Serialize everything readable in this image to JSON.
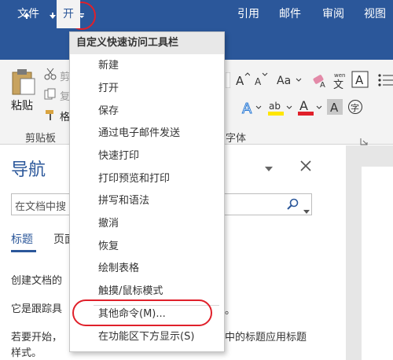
{
  "quick_access": {
    "undo_icon": "undo-up-arrow-icon",
    "redo_icon": "redo-down-arrow-icon",
    "customize_icon": "customize-dropdown-icon"
  },
  "tabs": [
    "文件",
    "开",
    "引用",
    "邮件",
    "审阅",
    "视图"
  ],
  "ribbon": {
    "paste_label": "粘贴",
    "cut_label": "剪",
    "copy_label": "复",
    "format_painter_label": "格",
    "clipboard_group": "剪贴板",
    "font_group": "字体"
  },
  "menu": {
    "header": "自定义快速访问工具栏",
    "items": [
      "新建",
      "打开",
      "保存",
      "通过电子邮件发送",
      "快速打印",
      "打印预览和打印",
      "拼写和语法",
      "撤消",
      "恢复",
      "绘制表格",
      "触摸/鼠标模式"
    ],
    "more_commands": "其他命令(M)...",
    "show_below": "在功能区下方显示(S)"
  },
  "nav": {
    "title": "导航",
    "search_placeholder": "在文档中搜",
    "tabs": [
      "标题",
      "页面"
    ],
    "lines": [
      "创建文档的",
      "它是跟踪具",
      "若要开始，",
      "样式。"
    ],
    "line_tail_2": "。",
    "line_tail_3": "中的标题应用标题"
  },
  "colors": {
    "brand": "#2b579a",
    "annotation": "#e0202a"
  }
}
